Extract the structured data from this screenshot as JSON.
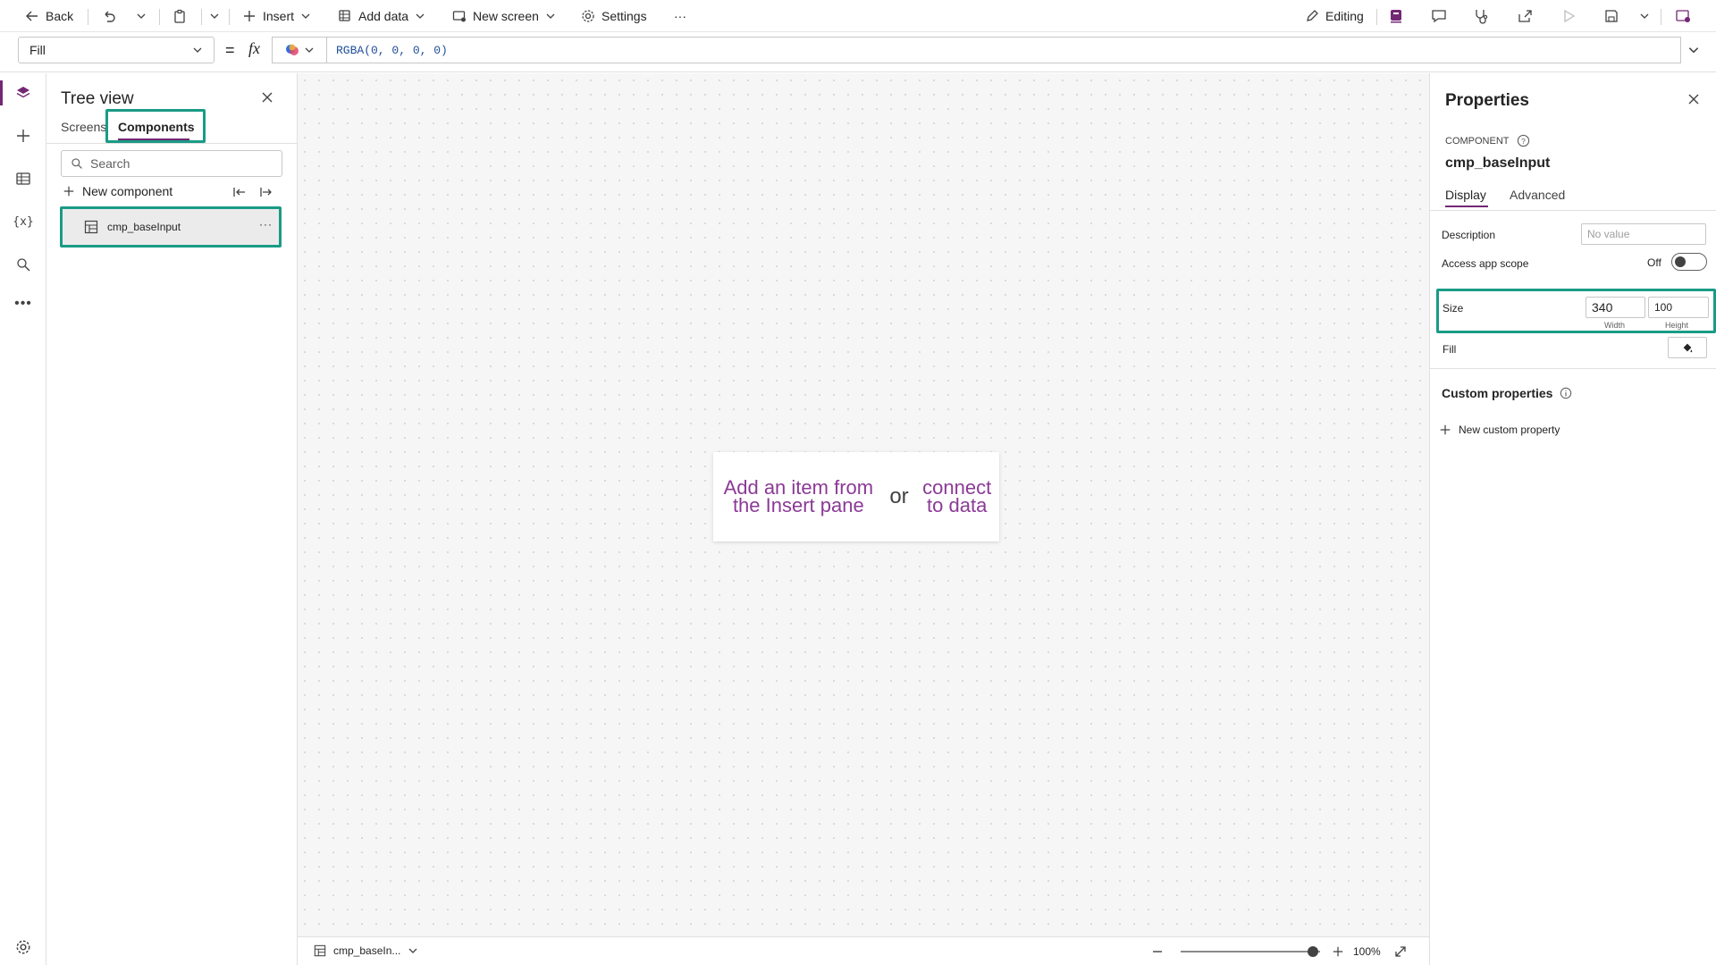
{
  "toolbar": {
    "back": "Back",
    "insert": "Insert",
    "add_data": "Add data",
    "new_screen": "New screen",
    "settings": "Settings",
    "more": "···",
    "editing": "Editing"
  },
  "formula": {
    "property": "Fill",
    "equals": "=",
    "fx": "fx",
    "value": "RGBA(0, 0, 0, 0)"
  },
  "tree": {
    "title": "Tree view",
    "tabs": [
      "Screens",
      "Components"
    ],
    "active_tab": "Components",
    "search_placeholder": "Search",
    "new_component": "New component",
    "items": [
      {
        "label": "cmp_baseInput",
        "more": "···"
      }
    ]
  },
  "canvas": {
    "placeholder_left": "Add an item from the Insert pane",
    "placeholder_or": "or",
    "placeholder_right": "connect to data"
  },
  "statusbar": {
    "component": "cmp_baseIn...",
    "zoom": "100%",
    "zoom_level": 0.5
  },
  "properties": {
    "title": "Properties",
    "kind": "COMPONENT",
    "name": "cmp_baseInput",
    "tabs": [
      "Display",
      "Advanced"
    ],
    "active_tab": "Display",
    "description_label": "Description",
    "description_placeholder": "No value",
    "access_label": "Access app scope",
    "access_value": "Off",
    "size_label": "Size",
    "width": "340",
    "height": "100",
    "width_label": "Width",
    "height_label": "Height",
    "fill_label": "Fill",
    "custom_title": "Custom properties",
    "new_custom": "New custom property"
  },
  "colors": {
    "accent": "#742774",
    "highlight": "#1a9b86",
    "link": "#8b3a96"
  }
}
